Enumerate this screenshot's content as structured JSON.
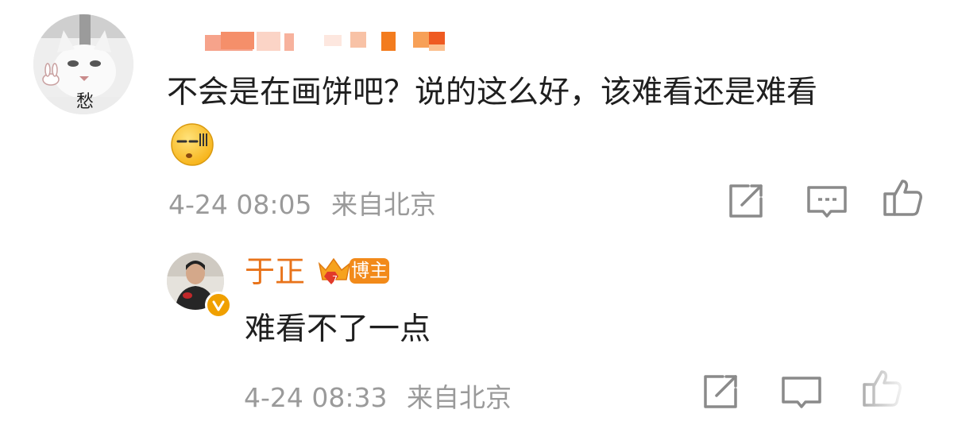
{
  "comment": {
    "text": "不会是在画饼吧？说的这么好，该难看还是难看",
    "avatar_caption": "愁",
    "emoji_icon": "squint-sweat-emoji",
    "timestamp": "4-24 08:05",
    "location": "来自北京",
    "actions": [
      "share-icon",
      "comment-icon",
      "like-icon"
    ]
  },
  "reply": {
    "author": "于正",
    "badge_label": "博主",
    "text": "难看不了一点",
    "timestamp": "4-24 08:33",
    "location": "来自北京",
    "actions": [
      "share-icon",
      "comment-icon",
      "like-icon"
    ]
  },
  "colors": {
    "accent": "#e8731a",
    "meta": "#9a9a9a",
    "icon": "#8a8a8a",
    "badge": "#f28a1a"
  }
}
